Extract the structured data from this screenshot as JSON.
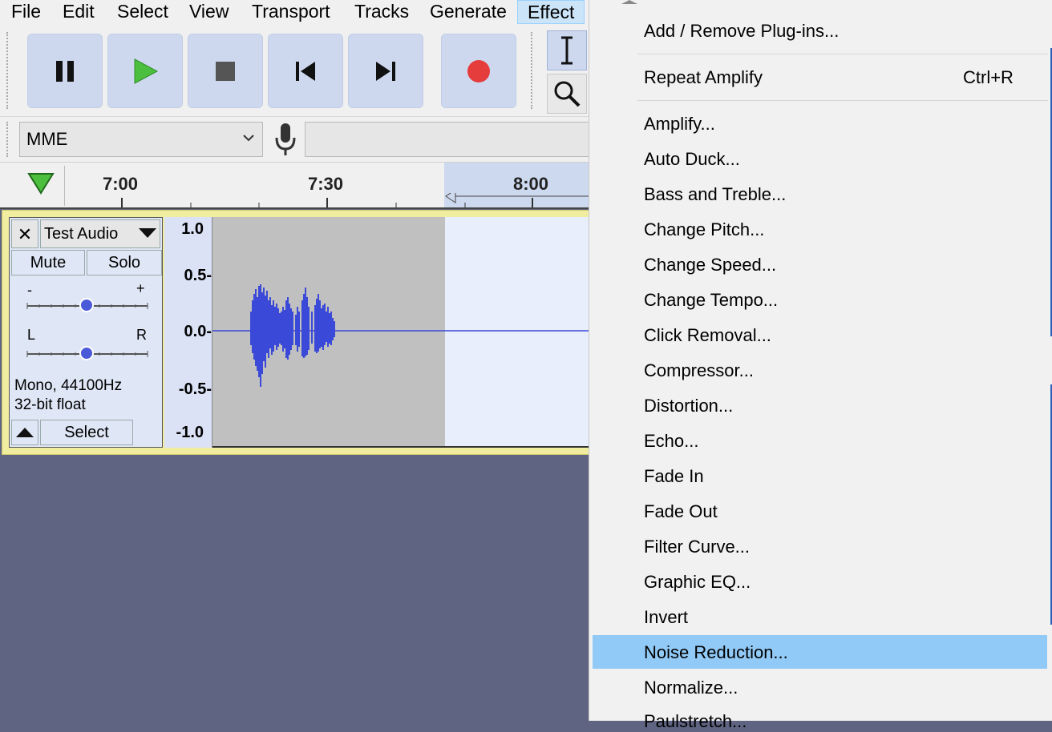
{
  "menubar": {
    "items": [
      {
        "label": "File"
      },
      {
        "label": "Edit"
      },
      {
        "label": "Select"
      },
      {
        "label": "View"
      },
      {
        "label": "Transport"
      },
      {
        "label": "Tracks"
      },
      {
        "label": "Generate"
      },
      {
        "label": "Effect"
      }
    ]
  },
  "device": {
    "host": "MME"
  },
  "timeline": {
    "ticks": [
      "7:00",
      "7:30",
      "8:00"
    ]
  },
  "track": {
    "name": "Test Audio",
    "close_glyph": "✕",
    "mute_label": "Mute",
    "solo_label": "Solo",
    "gain_minus": "-",
    "gain_plus": "+",
    "pan_left": "L",
    "pan_right": "R",
    "info_line1": "Mono, 44100Hz",
    "info_line2": "32-bit float",
    "select_label": "Select",
    "scale": [
      "1.0",
      "0.5-",
      "0.0-",
      "-0.5-",
      "-1.0"
    ]
  },
  "effect_menu": {
    "add_remove": "Add / Remove Plug-ins...",
    "repeat": "Repeat Amplify",
    "repeat_shortcut": "Ctrl+R",
    "items": [
      "Amplify...",
      "Auto Duck...",
      "Bass and Treble...",
      "Change Pitch...",
      "Change Speed...",
      "Change Tempo...",
      "Click Removal...",
      "Compressor...",
      "Distortion...",
      "Echo...",
      "Fade In",
      "Fade Out",
      "Filter Curve...",
      "Graphic EQ...",
      "Invert",
      "Noise Reduction...",
      "Normalize...",
      "Paulstretch..."
    ],
    "highlighted_item": "Noise Reduction..."
  },
  "colors": {
    "highlight": "#91c9f7",
    "waveform": "#3a49d8",
    "play_green": "#4cbf3e",
    "record_red": "#e53c3c"
  }
}
